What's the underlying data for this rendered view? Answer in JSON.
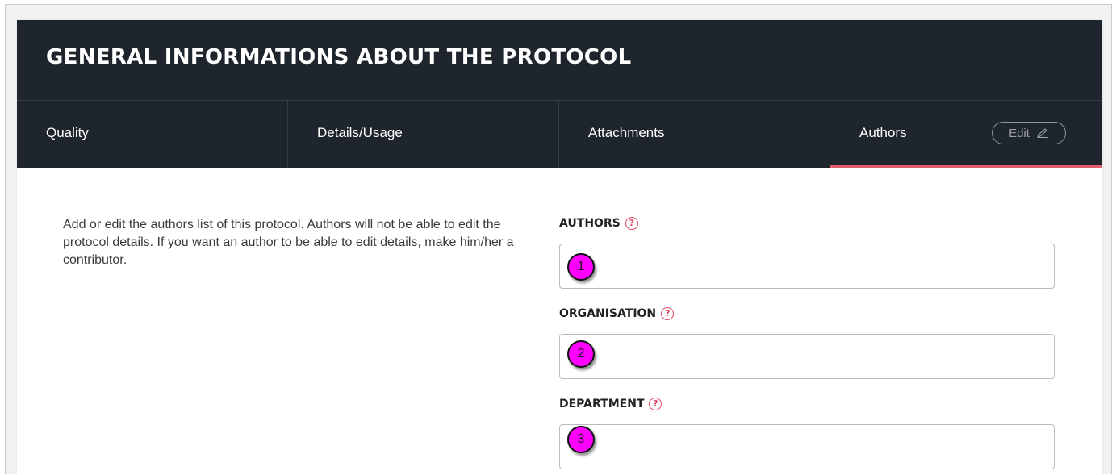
{
  "header": {
    "title": "GENERAL INFORMATIONS ABOUT THE PROTOCOL"
  },
  "tabs": [
    {
      "label": "Quality",
      "active": false
    },
    {
      "label": "Details/Usage",
      "active": false
    },
    {
      "label": "Attachments",
      "active": false
    },
    {
      "label": "Authors",
      "active": true
    }
  ],
  "edit_button": {
    "label": "Edit",
    "icon": "pencil-icon"
  },
  "description": "Add or edit the authors list of this protocol. Authors will not be able to edit the protocol details. If you want an author to be able to edit details, make him/her a contributor.",
  "fields": [
    {
      "label": "AUTHORS",
      "value": "",
      "marker": "1"
    },
    {
      "label": "ORGANISATION",
      "value": "",
      "marker": "2"
    },
    {
      "label": "DEPARTMENT",
      "value": "",
      "marker": "3"
    }
  ],
  "help_icon_glyph": "?",
  "colors": {
    "header_bg": "#1f252c",
    "active_tab_underline": "#e45a6e",
    "help_icon": "#e0435d",
    "marker": "#ff00ff"
  }
}
